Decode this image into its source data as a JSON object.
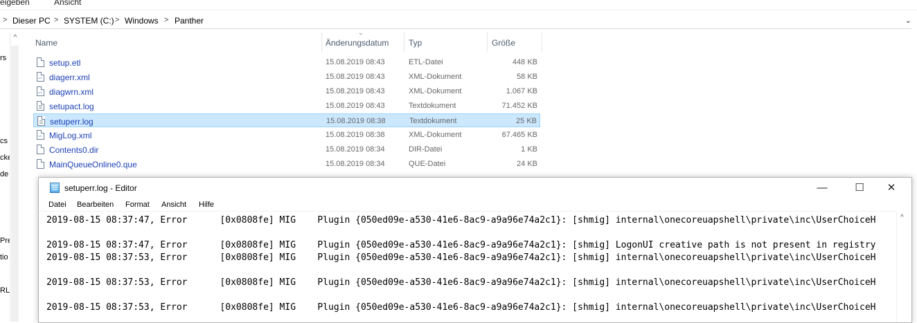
{
  "explorer": {
    "ribbon_tabs": [
      "reigeben",
      "Ansicht"
    ],
    "breadcrumb": [
      "Dieser PC",
      "SYSTEM (C:)",
      "Windows",
      "Panther"
    ],
    "nav_pane_fragments": [
      "rs",
      "cs",
      "cke",
      "de",
      "Pre",
      "tio",
      "RL"
    ],
    "columns": {
      "name": "Name",
      "date": "Änderungsdatum",
      "type": "Typ",
      "size": "Größe"
    },
    "files": [
      {
        "name": "setup.etl",
        "date": "15.08.2019 08:43",
        "type": "ETL-Datei",
        "size": "448 KB",
        "icon": "generic-file-icon"
      },
      {
        "name": "diagerr.xml",
        "date": "15.08.2019 08:43",
        "type": "XML-Dokument",
        "size": "58 KB",
        "icon": "xml-file-icon"
      },
      {
        "name": "diagwrn.xml",
        "date": "15.08.2019 08:43",
        "type": "XML-Dokument",
        "size": "1.067 KB",
        "icon": "xml-file-icon"
      },
      {
        "name": "setupact.log",
        "date": "15.08.2019 08:43",
        "type": "Textdokument",
        "size": "71.452 KB",
        "icon": "text-file-icon"
      },
      {
        "name": "setuperr.log",
        "date": "15.08.2019 08:38",
        "type": "Textdokument",
        "size": "25 KB",
        "icon": "text-file-icon",
        "selected": true
      },
      {
        "name": "MigLog.xml",
        "date": "15.08.2019 08:38",
        "type": "XML-Dokument",
        "size": "67.465 KB",
        "icon": "xml-file-icon"
      },
      {
        "name": "Contents0.dir",
        "date": "15.08.2019 08:34",
        "type": "DIR-Datei",
        "size": "1 KB",
        "icon": "generic-file-icon"
      },
      {
        "name": "MainQueueOnline0.que",
        "date": "15.08.2019 08:34",
        "type": "QUE-Datei",
        "size": "24 KB",
        "icon": "generic-file-icon"
      }
    ]
  },
  "notepad": {
    "title": "setuperr.log - Editor",
    "menu": [
      "Datei",
      "Bearbeiten",
      "Format",
      "Ansicht",
      "Hilfe"
    ],
    "window_buttons": {
      "minimize": "—",
      "maximize": "☐",
      "close": "✕"
    },
    "lines": [
      "2019-08-15 08:37:47, Error      [0x0808fe] MIG    Plugin {050ed09e-a530-41e6-8ac9-a9a96e74a2c1}: [shmig] internal\\onecoreuapshell\\private\\inc\\UserChoiceH",
      "",
      "2019-08-15 08:37:47, Error      [0x0808fe] MIG    Plugin {050ed09e-a530-41e6-8ac9-a9a96e74a2c1}: [shmig] LogonUI creative path is not present in registry",
      "2019-08-15 08:37:53, Error      [0x0808fe] MIG    Plugin {050ed09e-a530-41e6-8ac9-a9a96e74a2c1}: [shmig] internal\\onecoreuapshell\\private\\inc\\UserChoiceH",
      "",
      "2019-08-15 08:37:53, Error      [0x0808fe] MIG    Plugin {050ed09e-a530-41e6-8ac9-a9a96e74a2c1}: [shmig] internal\\onecoreuapshell\\private\\inc\\UserChoiceH",
      "",
      "2019-08-15 08:37:53, Error      [0x0808fe] MIG    Plugin {050ed09e-a530-41e6-8ac9-a9a96e74a2c1}: [shmig] internal\\onecoreuapshell\\private\\inc\\UserChoiceH"
    ]
  }
}
